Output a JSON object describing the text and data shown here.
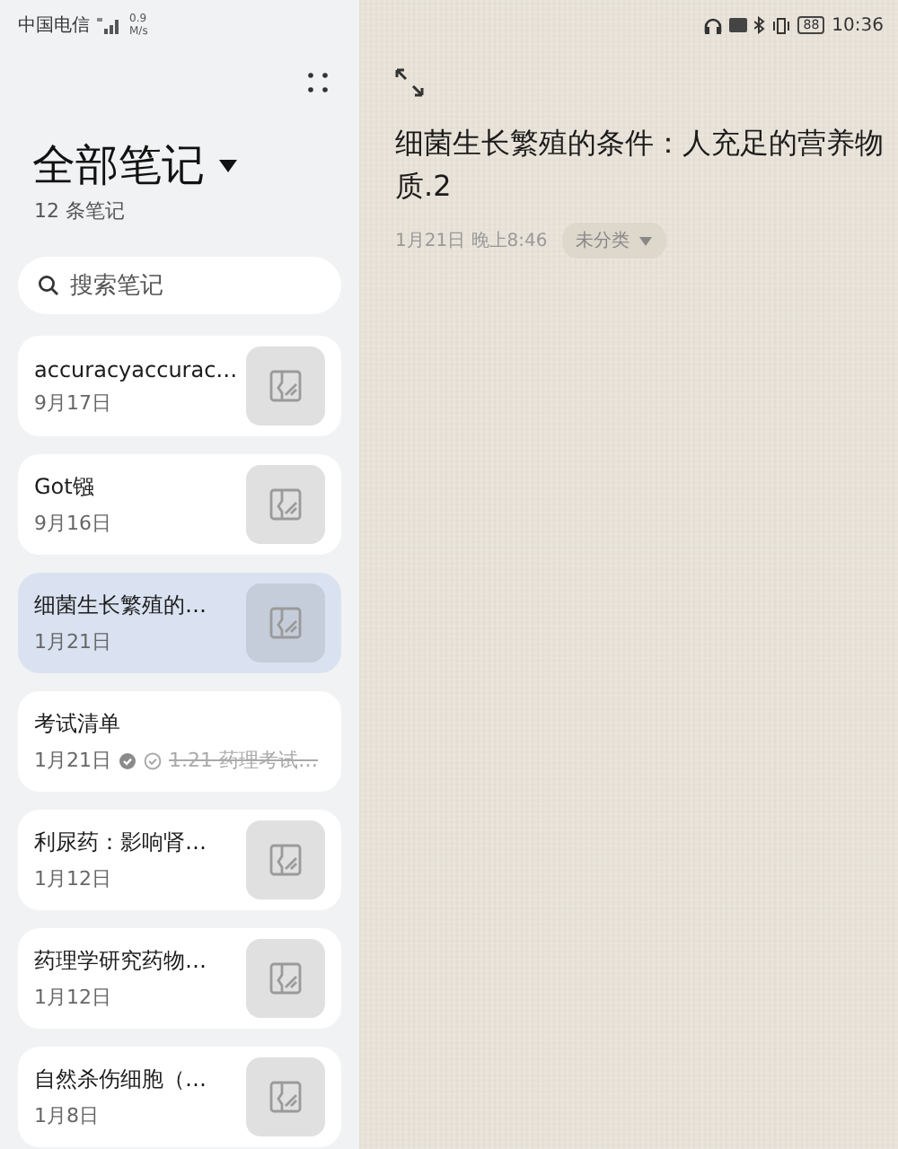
{
  "status_bar": {
    "carrier": "中国电信",
    "network_speed": "0.9",
    "network_speed_unit": "M/s",
    "battery": "88",
    "time": "10:36"
  },
  "sidebar": {
    "title": "全部笔记",
    "count": "12 条笔记",
    "search": {
      "placeholder": "搜索笔记"
    },
    "notes": [
      {
        "kind": "image",
        "title": "accuracyaccurac…",
        "date": "9月17日",
        "selected": false
      },
      {
        "kind": "image",
        "title": "Got镪",
        "date": "9月16日",
        "selected": false
      },
      {
        "kind": "image",
        "title": "细菌生长繁殖的…",
        "date": "1月21日",
        "selected": true
      },
      {
        "kind": "checklist",
        "title": "考试清单",
        "date": "1月21日",
        "preview": "1.21 药理考试…",
        "preview_done": true,
        "selected": false
      },
      {
        "kind": "image",
        "title": "利尿药：影响肾…",
        "date": "1月12日",
        "selected": false
      },
      {
        "kind": "image",
        "title": "药理学研究药物…",
        "date": "1月12日",
        "selected": false
      },
      {
        "kind": "image",
        "title": "自然杀伤细胞（…",
        "date": "1月8日",
        "selected": false
      }
    ]
  },
  "editor": {
    "title": "细菌生长繁殖的条件：人充足的营养物质.2",
    "date": "1月21日 晚上8:46",
    "category": "未分类"
  }
}
